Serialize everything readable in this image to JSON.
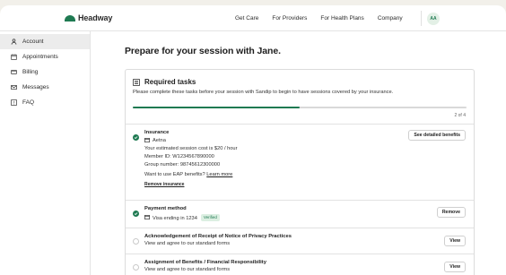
{
  "brand": {
    "name": "Headway",
    "accent": "#1f7a52"
  },
  "nav": {
    "links": [
      "Get Care",
      "For Providers",
      "For Health Plans",
      "Company"
    ],
    "avatar": "AA"
  },
  "sidebar": {
    "items": [
      {
        "label": "Account",
        "icon": "user-icon",
        "active": true
      },
      {
        "label": "Appointments",
        "icon": "calendar-icon",
        "active": false
      },
      {
        "label": "Billing",
        "icon": "card-icon",
        "active": false
      },
      {
        "label": "Messages",
        "icon": "mail-icon",
        "active": false
      },
      {
        "label": "FAQ",
        "icon": "question-icon",
        "active": false
      }
    ]
  },
  "page": {
    "title": "Prepare for your session with Jane."
  },
  "tasks_card": {
    "title": "Required tasks",
    "subtitle": "Please complete these tasks before your session with Sandip to begin to have sessions covered by your insurance.",
    "progress": {
      "completed": 2,
      "total": 4,
      "label": "2 of 4"
    }
  },
  "insurance": {
    "title": "Insurance",
    "provider": "Aetna",
    "cost": "Your estimated session cost is $20 / hour",
    "member_id": "Member ID: W1234567890000",
    "group_number": "Group number: 98745612300000",
    "eap_prefix": "Want to use EAP benefits? ",
    "eap_link": "Learn more",
    "remove_link": "Remove insurance",
    "button": "See detailed benefits"
  },
  "payment": {
    "title": "Payment method",
    "card": "Visa ending in 1234",
    "badge": "Verified",
    "button": "Remove"
  },
  "privacy": {
    "title": "Acknowledgement of Receipt of Notice of Privacy Practices",
    "description": "View and agree to our standard forms",
    "button": "View"
  },
  "benefits": {
    "title": "Assignment of Benefits / Financial Responsibility",
    "description": "View and agree to our standard forms",
    "button": "View"
  }
}
